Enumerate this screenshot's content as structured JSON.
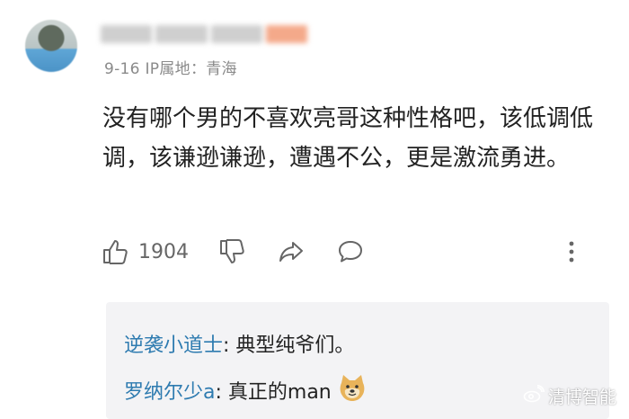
{
  "comment": {
    "meta": "9-16 IP属地：青海",
    "text": "没有哪个男的不喜欢亮哥这种性格吧，该低调低调，该谦逊谦逊，遭遇不公，更是激流勇进。",
    "likes": "1904"
  },
  "replies": [
    {
      "name": "逆袭小道士",
      "text": ": 典型纯爷们。"
    },
    {
      "name": "罗纳尔少a",
      "text": ": 真正的man"
    }
  ],
  "watermark": "清博智能",
  "colors": {
    "reply_name": "#2e7bb0",
    "reply_bg": "#f3f3f5",
    "meta": "#8a8a8a"
  },
  "icons": [
    "thumbs-up-icon",
    "thumbs-down-icon",
    "share-icon",
    "comment-icon",
    "more-vertical-icon",
    "doge-emoji-icon",
    "weibo-logo-icon"
  ]
}
